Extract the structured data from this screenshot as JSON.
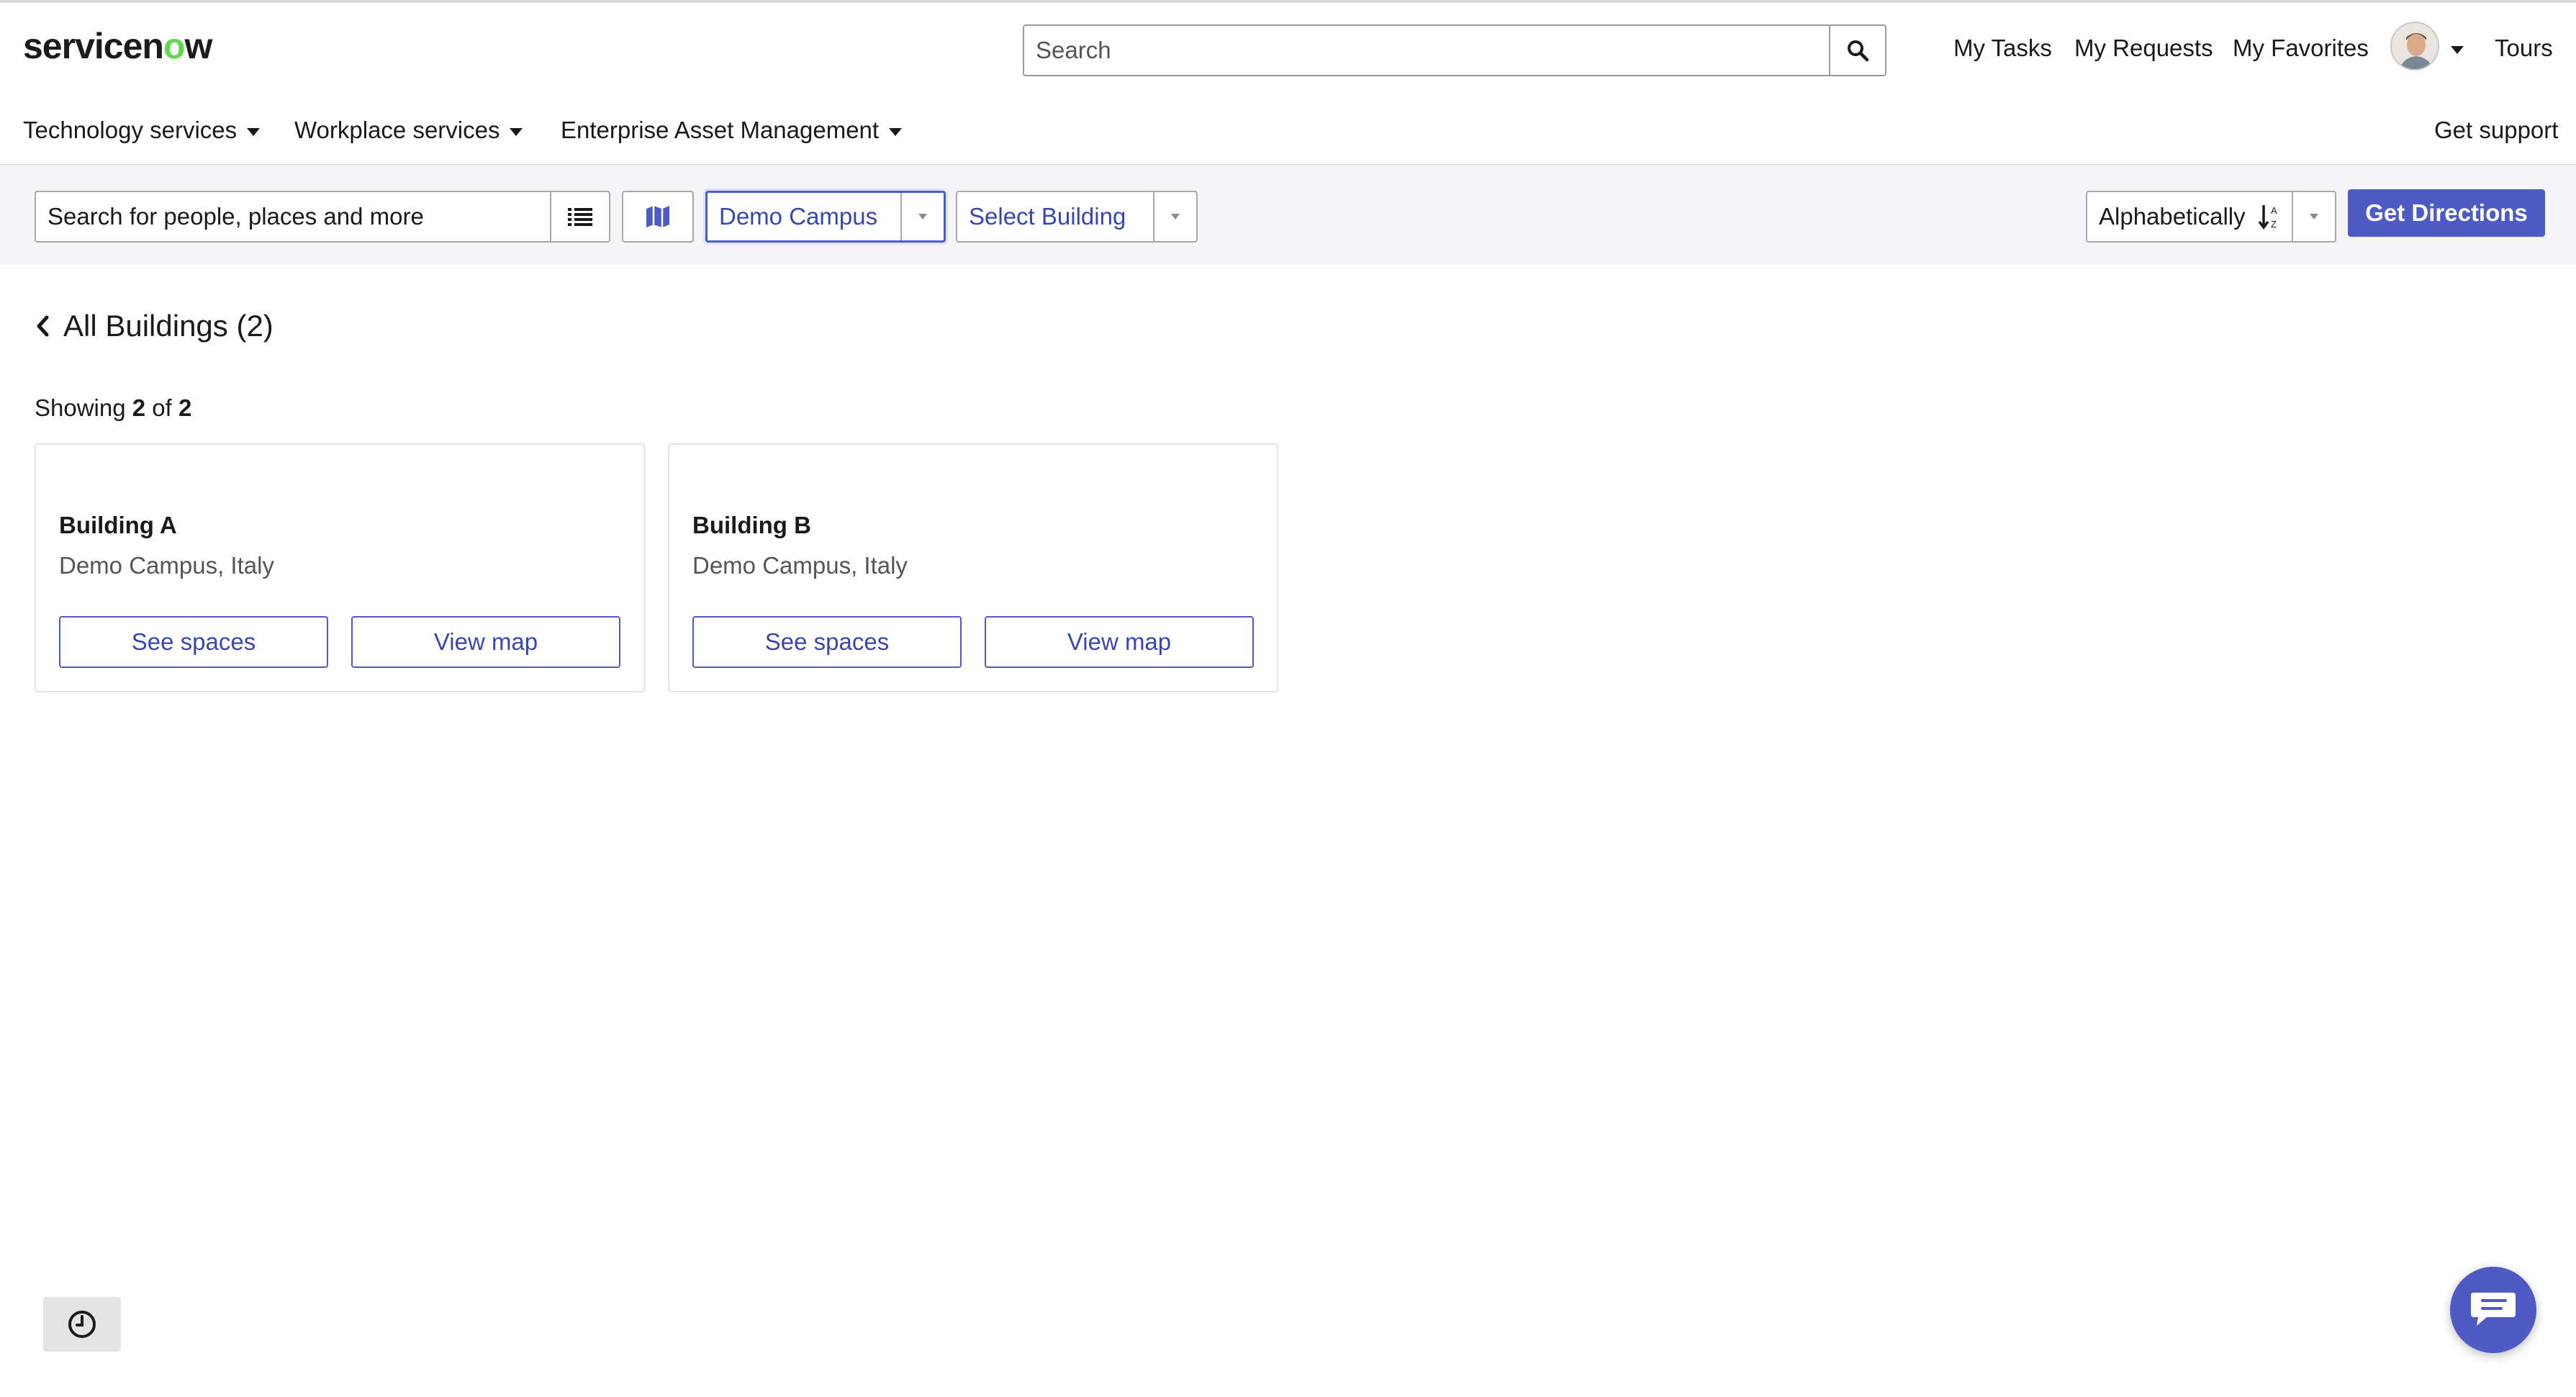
{
  "header": {
    "logo_text_pre": "servicen",
    "logo_text_o": "o",
    "logo_text_post": "w",
    "search_placeholder": "Search",
    "links": [
      "My Tasks",
      "My Requests",
      "My Favorites",
      "Tours"
    ]
  },
  "nav": {
    "items": [
      "Technology services",
      "Workplace services",
      "Enterprise Asset Management"
    ],
    "support": "Get support"
  },
  "toolbar": {
    "search_placeholder": "Search for people, places and more",
    "campus_select": "Demo Campus",
    "building_select": "Select Building",
    "sort_select": "Alphabetically",
    "get_directions": "Get Directions"
  },
  "content": {
    "back_title": "All Buildings (2)",
    "showing_prefix": "Showing",
    "showing_count": "2",
    "showing_of": "of",
    "showing_total": "2",
    "buildings": [
      {
        "name": "Building A",
        "location": "Demo Campus, Italy",
        "see_spaces": "See spaces",
        "view_map": "View map"
      },
      {
        "name": "Building B",
        "location": "Demo Campus, Italy",
        "see_spaces": "See spaces",
        "view_map": "View map"
      }
    ]
  },
  "colors": {
    "accent": "#4f5bc4",
    "accent_text": "#3a46b0",
    "logo_green": "#62d84e"
  }
}
